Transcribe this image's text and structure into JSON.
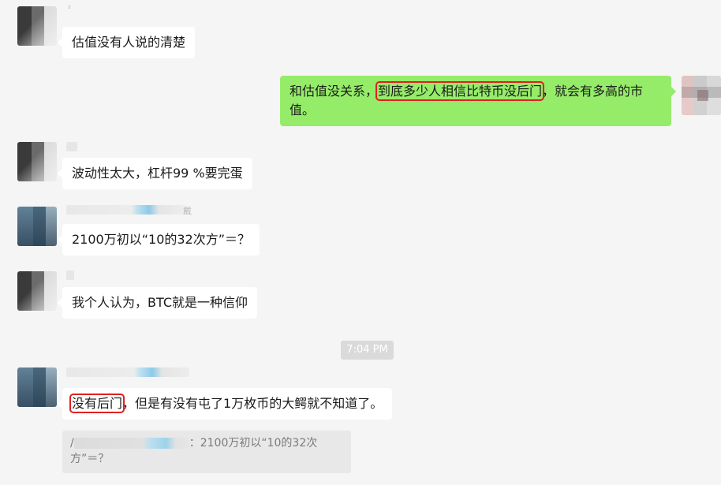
{
  "messages": [
    {
      "side": "left",
      "sender_mark": "²",
      "text": "估值没有人说的清楚"
    },
    {
      "side": "right",
      "text_before": "和估值没关系，",
      "text_highlight": "到底多少人相信比特币没后门",
      "text_after": "，就会有多高的市值。"
    },
    {
      "side": "left",
      "text": "波动性太大，杠杆99 %要完蛋"
    },
    {
      "side": "left",
      "sender_suffix": "戴",
      "text": "2100万初以“10的32次方”＝？"
    },
    {
      "side": "left",
      "text": "我个人认为，BTC就是一种信仰"
    },
    {
      "side": "left",
      "text_highlight": "没有后门",
      "text_after": "，但是有没有屯了1万枚币的大鳄就不知道了。"
    }
  ],
  "timestamp": "7:04 PM",
  "quote": {
    "prefix": "/",
    "text": "：2100万初以“10的32次方”＝？"
  }
}
